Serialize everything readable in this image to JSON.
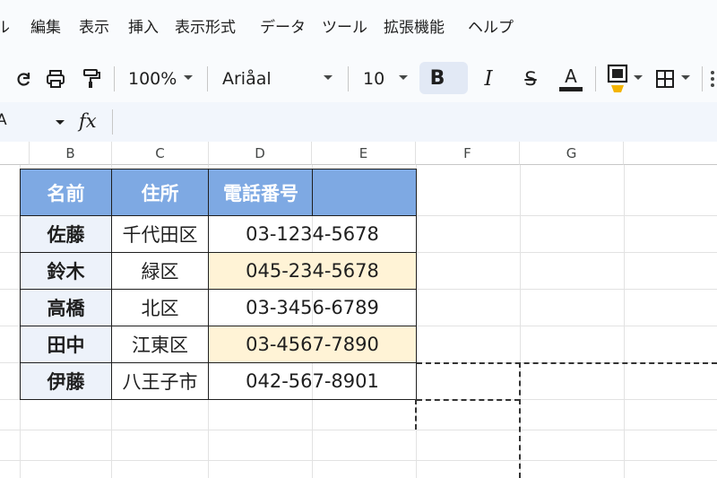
{
  "menu": [
    "ル",
    "編集",
    "表示",
    "挿入",
    "表示形式",
    "データ",
    "ツール",
    "拡張機能",
    "ヘルプ"
  ],
  "toolbar": {
    "zoom": "100%",
    "font": "Ariåal",
    "font_size": "10",
    "bold_label": "B",
    "italic_label": "I",
    "strike_label": "S",
    "text_color_label": "A",
    "text_color": "#1f1f1f",
    "fill_color": "#f4b400"
  },
  "formula_bar": {
    "name_box": "A",
    "fx": "fx"
  },
  "columns": [
    "B",
    "C",
    "D",
    "E",
    "F",
    "G"
  ],
  "table": {
    "headers": [
      "名前",
      "住所",
      "電話番号",
      ""
    ],
    "rows": [
      {
        "name": "佐藤",
        "address": "千代田区",
        "phone": "03-1234-5678",
        "highlight": false
      },
      {
        "name": "鈴木",
        "address": "緑区",
        "phone": "045-234-5678",
        "highlight": true
      },
      {
        "name": "高橋",
        "address": "北区",
        "phone": "03-3456-6789",
        "highlight": false
      },
      {
        "name": "田中",
        "address": "江東区",
        "phone": "03-4567-7890",
        "highlight": true
      },
      {
        "name": "伊藤",
        "address": "八王子市",
        "phone": "042-567-8901",
        "highlight": false
      }
    ]
  },
  "colors": {
    "header_fill": "#7ea9e3",
    "name_fill": "#edf2fa",
    "highlight_fill": "#fff3d6"
  }
}
